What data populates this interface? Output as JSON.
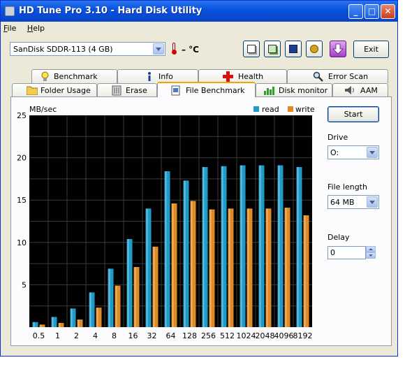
{
  "window": {
    "title": "HD Tune Pro 3.10 - Hard Disk Utility",
    "buttons": {
      "minimize": "_",
      "maximize": "□",
      "close": "✕"
    }
  },
  "menu": [
    "File",
    "Help"
  ],
  "toolbar": {
    "drive": "SanDisk SDDR-113 (4 GB)",
    "temperature": "– °C",
    "icons": [
      "copy-text-icon",
      "copy-screenshot-icon",
      "save-icon",
      "options-icon",
      "download-icon"
    ],
    "exit_label": "Exit"
  },
  "tabs": {
    "row1": [
      {
        "label": "Benchmark",
        "icon": "benchmark-bulb-icon"
      },
      {
        "label": "Info",
        "icon": "info-icon"
      },
      {
        "label": "Health",
        "icon": "health-cross-icon"
      },
      {
        "label": "Error Scan",
        "icon": "magnifier-icon"
      }
    ],
    "row2": [
      {
        "label": "Folder Usage",
        "icon": "folder-icon"
      },
      {
        "label": "Erase",
        "icon": "erase-icon"
      },
      {
        "label": "File Benchmark",
        "icon": "file-benchmark-icon",
        "active": true
      },
      {
        "label": "Disk monitor",
        "icon": "disk-monitor-icon"
      },
      {
        "label": "AAM",
        "icon": "speaker-icon"
      }
    ]
  },
  "chart_data": {
    "type": "bar",
    "title": "",
    "ylabel": "MB/sec",
    "xlabel": "",
    "categories": [
      "0.5",
      "1",
      "2",
      "4",
      "8",
      "16",
      "32",
      "64",
      "128",
      "256",
      "512",
      "1024",
      "2048",
      "4096",
      "8192"
    ],
    "ylim": [
      0,
      25
    ],
    "yticks": [
      5,
      10,
      15,
      20,
      25
    ],
    "grid": true,
    "legend_position": "top-right",
    "series": [
      {
        "name": "read",
        "color": "#1e9bc8",
        "values": [
          0.6,
          1.2,
          2.2,
          4.1,
          6.9,
          10.4,
          14.0,
          18.4,
          17.3,
          18.9,
          19.0,
          19.1,
          19.1,
          19.1,
          18.9
        ]
      },
      {
        "name": "write",
        "color": "#e08a24",
        "values": [
          0.3,
          0.5,
          0.9,
          2.3,
          4.9,
          7.1,
          9.5,
          14.6,
          14.9,
          13.9,
          14.0,
          14.0,
          14.0,
          14.1,
          13.2
        ]
      }
    ]
  },
  "controls": {
    "start_label": "Start",
    "drive_label": "Drive",
    "drive_value": "O:",
    "file_length_label": "File length",
    "file_length_value": "64 MB",
    "delay_label": "Delay",
    "delay_value": "0"
  }
}
